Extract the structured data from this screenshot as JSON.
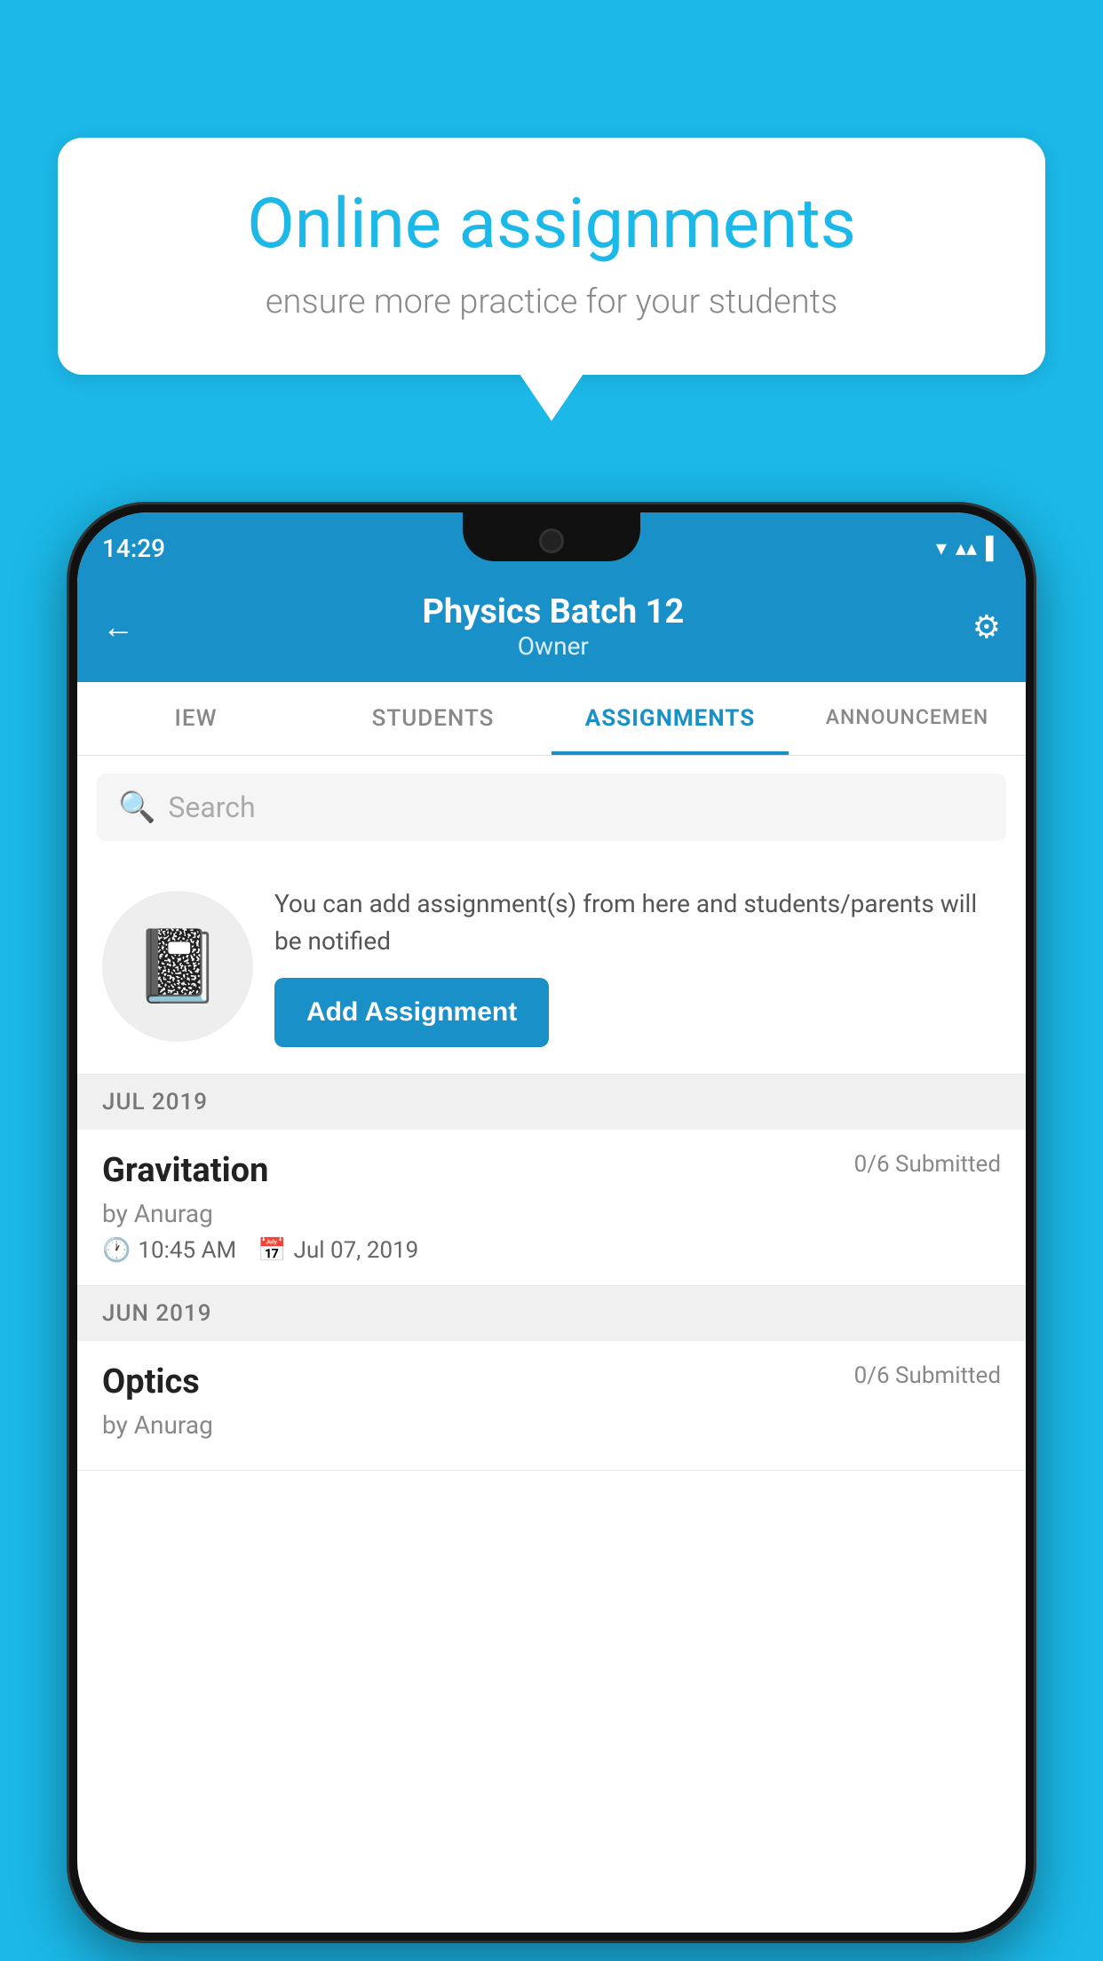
{
  "background_color": "#1BB8E8",
  "bubble": {
    "title": "Online assignments",
    "subtitle": "ensure more practice for your students"
  },
  "status_bar": {
    "time": "14:29",
    "wifi_icon": "▼",
    "signal_icon": "▲",
    "battery_icon": "▌"
  },
  "header": {
    "title": "Physics Batch 12",
    "subtitle": "Owner",
    "back_label": "←",
    "settings_label": "⚙"
  },
  "tabs": [
    {
      "id": "iew",
      "label": "IEW"
    },
    {
      "id": "students",
      "label": "STUDENTS"
    },
    {
      "id": "assignments",
      "label": "ASSIGNMENTS",
      "active": true
    },
    {
      "id": "announcements",
      "label": "ANNOUNCEMEN"
    }
  ],
  "search": {
    "placeholder": "Search"
  },
  "add_assignment_promo": {
    "description": "You can add assignment(s) from here and students/parents will be notified",
    "button_label": "Add Assignment"
  },
  "sections": [
    {
      "month_label": "JUL 2019",
      "items": [
        {
          "name": "Gravitation",
          "submitted": "0/6 Submitted",
          "author": "by Anurag",
          "time": "10:45 AM",
          "date": "Jul 07, 2019"
        }
      ]
    },
    {
      "month_label": "JUN 2019",
      "items": [
        {
          "name": "Optics",
          "submitted": "0/6 Submitted",
          "author": "by Anurag",
          "time": "",
          "date": ""
        }
      ]
    }
  ]
}
